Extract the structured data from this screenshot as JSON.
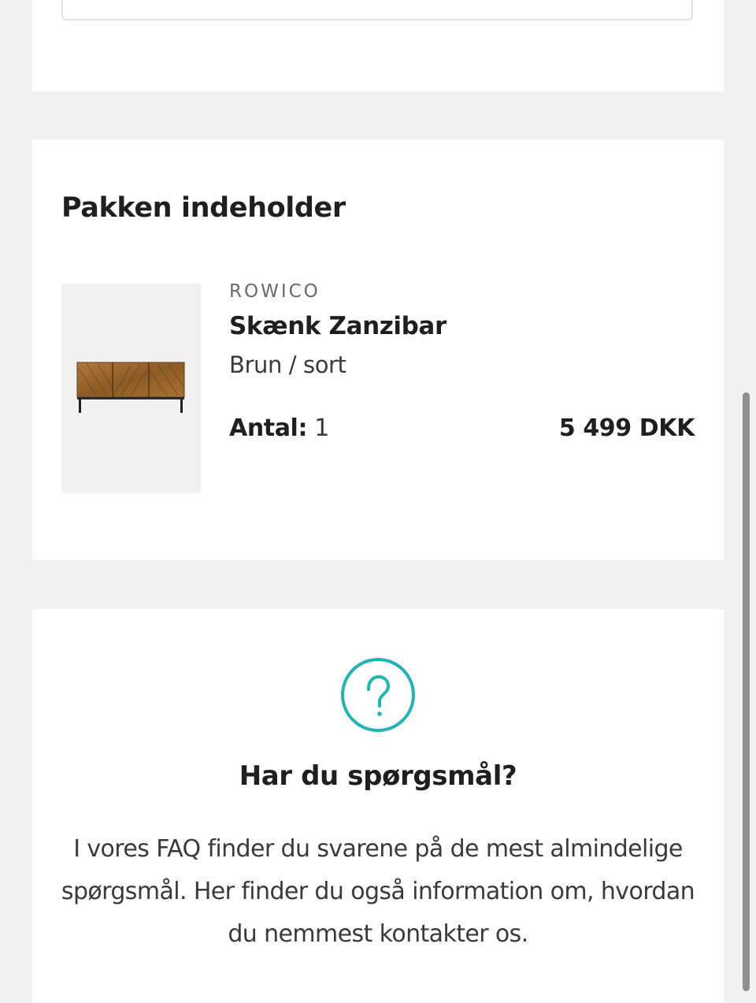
{
  "package": {
    "title": "Pakken indeholder",
    "item": {
      "brand": "ROWICO",
      "name": "Skænk Zanzibar",
      "variant": "Brun / sort",
      "quantity_label": "Antal:",
      "quantity": "1",
      "price": "5 499 DKK",
      "image_icon": "sideboard-image"
    }
  },
  "faq": {
    "icon": "question-circle-icon",
    "title": "Har du spørgsmål?",
    "text": "I vores FAQ finder du svarene på de mest almindelige spørgsmål. Her finder du også information om, hvordan du nemmest kontakter os."
  },
  "colors": {
    "accent": "#20b5b4",
    "background": "#f1f1f1",
    "card": "#ffffff",
    "text": "#1f1f1f"
  }
}
